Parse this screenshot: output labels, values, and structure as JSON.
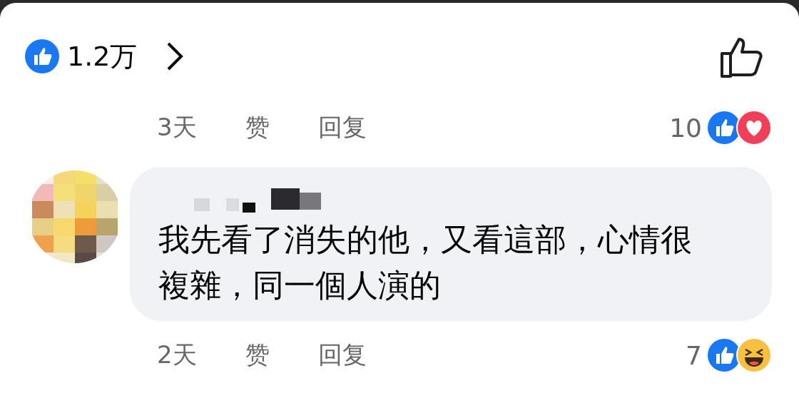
{
  "header": {
    "reaction_count": "1.2万"
  },
  "comments": [
    {
      "has_bubble": false,
      "actions": {
        "time": "3天",
        "like": "赞",
        "reply": "回复"
      },
      "reactions": {
        "count": "10",
        "types": [
          {
            "kind": "like"
          },
          {
            "kind": "love"
          }
        ]
      }
    },
    {
      "has_bubble": true,
      "text": "我先看了消失的他，又看這部，心情很複雜，同一個人演的",
      "actions": {
        "time": "2天",
        "like": "赞",
        "reply": "回复"
      },
      "reactions": {
        "count": "7",
        "types": [
          {
            "kind": "like"
          },
          {
            "kind": "haha"
          }
        ]
      }
    }
  ]
}
